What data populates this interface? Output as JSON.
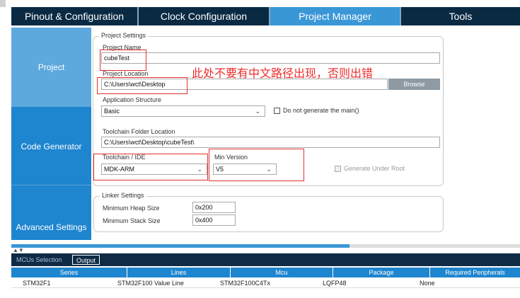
{
  "tabs": [
    {
      "label": "Pinout & Configuration"
    },
    {
      "label": "Clock Configuration"
    },
    {
      "label": "Project Manager"
    },
    {
      "label": "Tools"
    }
  ],
  "sidebar": {
    "items": [
      {
        "label": "Project"
      },
      {
        "label": "Code Generator"
      },
      {
        "label": "Advanced Settings"
      }
    ]
  },
  "project_settings": {
    "legend": "Project Settings",
    "name_label": "Project Name",
    "name_value": "cubeTest",
    "location_label": "Project Location",
    "location_value": "C:\\Users\\wct\\Desktop",
    "browse_label": "Browse",
    "structure_label": "Application Structure",
    "structure_value": "Basic",
    "do_not_generate_main_label": "Do not generate the main()",
    "toolchain_folder_label": "Toolchain Folder Location",
    "toolchain_folder_value": "C:\\Users\\wct\\Desktop\\cubeTest\\",
    "toolchain_ide_label": "Toolchain / IDE",
    "toolchain_ide_value": "MDK-ARM",
    "min_version_label": "Min Version",
    "min_version_value": "V5",
    "generate_under_root_label": "Generate Under Root"
  },
  "annotation": {
    "note": "此处不要有中文路径出现，否则出错",
    "color": "#ee2a2a"
  },
  "linker_settings": {
    "legend": "Linker Settings",
    "heap_label": "Minimum Heap Size",
    "heap_value": "0x200",
    "stack_label": "Minimum Stack Size",
    "stack_value": "0x400"
  },
  "lower_tabs": [
    {
      "label": "MCUs Selection"
    },
    {
      "label": "Output"
    }
  ],
  "table": {
    "columns": [
      "Series",
      "Lines",
      "Mcu",
      "Package",
      "Required Peripherals"
    ],
    "rows": [
      [
        "STM32F1",
        "STM32F100 Value Line",
        "STM32F100C4Tx",
        "LQFP48",
        "None"
      ]
    ]
  },
  "colors": {
    "tab_bar": "#0a2a44",
    "tab_active": "#3a97d6",
    "sidebar_active": "#5da8dd",
    "sidebar": "#1e85cf"
  }
}
